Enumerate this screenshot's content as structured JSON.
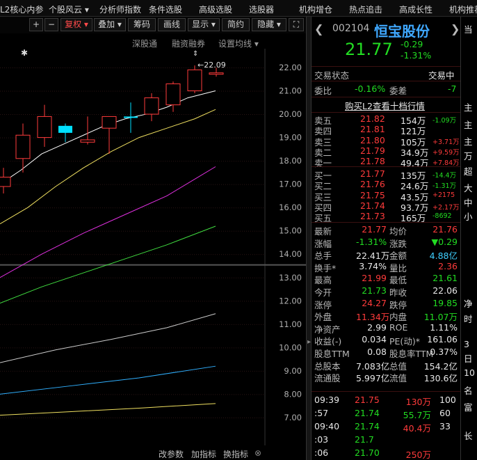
{
  "nav": {
    "items": [
      "L2核心内参",
      "个股风云 ▾",
      "分析师指数",
      "条件选股",
      "高级选股",
      "选股器",
      "机构增仓",
      "热点追击",
      "高成长性",
      "机构推荐"
    ]
  },
  "toolbar": {
    "plus": "+",
    "minus": "−",
    "fuquan": "复权 ▾",
    "diejia": "叠加 ▾",
    "chouma": "筹码",
    "huaxian": "画线",
    "xianshi": "显示 ▾",
    "jianyue": "简约",
    "yincang": "隐藏 ▾",
    "expand": "⛶"
  },
  "subbar": {
    "shengu": "深股通",
    "rongzi": "融资融券",
    "junxian": "设置均线 ▾"
  },
  "bottombar": {
    "gaicanshu": "改参数",
    "jiazhibiao": "加指标",
    "huanzhibiao": "换指标",
    "more": "⊗"
  },
  "chart_data": {
    "type": "candlestick",
    "yticks": [
      "22.00",
      "21.00",
      "20.00",
      "19.00",
      "18.00",
      "17.00",
      "16.00",
      "15.00",
      "14.00",
      "13.00",
      "12.00",
      "11.00",
      "10.00",
      "9.00",
      "8.00",
      "7.00"
    ],
    "high_label": "22.09",
    "candles": [
      {
        "o": 16.9,
        "c": 17.3,
        "h": 17.7,
        "l": 16.6,
        "up": true
      },
      {
        "o": 18.1,
        "c": 19.1,
        "h": 19.6,
        "l": 17.5,
        "up": true
      },
      {
        "o": 19.0,
        "c": 19.9,
        "h": 20.4,
        "l": 18.6,
        "up": true
      },
      {
        "o": 19.5,
        "c": 19.2,
        "h": 19.6,
        "l": 18.8,
        "up": false
      },
      {
        "o": 18.8,
        "c": 18.9,
        "h": 19.9,
        "l": 18.7,
        "up": true
      },
      {
        "o": 19.4,
        "c": 19.9,
        "h": 19.9,
        "l": 18.3,
        "up": true
      },
      {
        "o": 19.9,
        "c": 19.9,
        "h": 20.5,
        "l": 19.2,
        "up": false
      },
      {
        "o": 20.0,
        "c": 20.7,
        "h": 20.9,
        "l": 19.7,
        "up": true
      },
      {
        "o": 20.4,
        "c": 21.3,
        "h": 21.4,
        "l": 20.1,
        "up": true
      },
      {
        "o": 21.0,
        "c": 21.9,
        "h": 22.09,
        "l": 20.9,
        "up": true
      },
      {
        "o": 21.73,
        "c": 21.77,
        "h": 21.99,
        "l": 21.61,
        "up": true
      }
    ]
  },
  "quote": {
    "code": "002104",
    "name": "恒宝股份",
    "price": "21.77",
    "change": "-0.29",
    "pct": "-1.31%",
    "status_label": "交易状态",
    "status_val": "交易中",
    "weibi_label": "委比",
    "weibi": "-0.16%",
    "weicha_label": "委差",
    "weicha": "-7",
    "l2link": "购买L2查看十档行情",
    "sells": [
      [
        "卖五",
        "21.82",
        "154万",
        "-1.09万"
      ],
      [
        "卖四",
        "21.81",
        "121万",
        ""
      ],
      [
        "卖三",
        "21.80",
        "105万",
        "+3.71万"
      ],
      [
        "卖二",
        "21.79",
        "34.9万",
        "+9.59万"
      ],
      [
        "卖一",
        "21.78",
        "49.4万",
        "+7.84万"
      ]
    ],
    "buys": [
      [
        "买一",
        "21.77",
        "135万",
        "-14.4万"
      ],
      [
        "买二",
        "21.76",
        "24.6万",
        "-1.31万"
      ],
      [
        "买三",
        "21.75",
        "43.5万",
        "+2175"
      ],
      [
        "买四",
        "21.74",
        "93.7万",
        "+2.17万"
      ],
      [
        "买五",
        "21.73",
        "165万",
        "-8692"
      ]
    ],
    "stats": [
      [
        "最新",
        "21.77",
        "均价",
        "21.76"
      ],
      [
        "涨幅",
        "-1.31%",
        "涨跌",
        "▼0.29"
      ],
      [
        "总手",
        "22.41万",
        "金额",
        "4.88亿"
      ],
      [
        "换手*",
        "3.74%",
        "量比",
        "2.36"
      ],
      [
        "最高",
        "21.99",
        "最低",
        "21.61"
      ],
      [
        "今开",
        "21.73",
        "昨收",
        "22.06"
      ],
      [
        "涨停",
        "24.27",
        "跌停",
        "19.85"
      ],
      [
        "外盘",
        "11.34万",
        "内盘",
        "11.07万"
      ],
      [
        "净资产",
        "2.99",
        "ROE",
        "1.11%"
      ],
      [
        "收益(-)",
        "0.034",
        "PE(动)*",
        "161.06"
      ],
      [
        "股息TTM",
        "0.08",
        "股息率TTM",
        "0.37%"
      ],
      [
        "总股本",
        "7.083亿",
        "总值",
        "154.2亿"
      ],
      [
        "流通股",
        "5.997亿",
        "流值",
        "130.6亿"
      ]
    ],
    "ticks": [
      [
        "09:39",
        "21.75",
        "130万",
        "100"
      ],
      [
        ":57",
        "21.74",
        "55.7万",
        "60"
      ],
      [
        "09:40",
        "21.74",
        "40.4万",
        "33"
      ],
      [
        ":03",
        "21.7",
        "",
        " "
      ],
      [
        ":06",
        "21.70",
        "250万",
        ""
      ]
    ]
  },
  "farright": {
    "items": [
      "当",
      "主",
      "主",
      "主",
      "万",
      "超",
      "大",
      "中",
      "小",
      "净",
      "时",
      "3",
      "日",
      "10",
      "名",
      "富",
      "长"
    ]
  }
}
